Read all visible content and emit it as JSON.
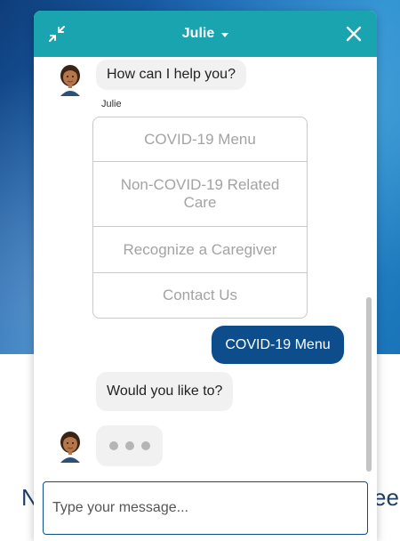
{
  "header": {
    "title": "Julie"
  },
  "conversation": {
    "bot_greeting": "How can I help you?",
    "sender_name": "Julie",
    "menu_options": [
      "COVID-19 Menu",
      "Non-COVID-19 Related Care",
      "Recognize a Caregiver",
      "Contact Us"
    ],
    "user_reply": "COVID-19 Menu",
    "bot_followup": "Would you like to?"
  },
  "composer": {
    "placeholder": "Type your message..."
  },
  "background": {
    "text_left": "N",
    "text_right": "ee"
  },
  "colors": {
    "header": "#1aa4b0",
    "user_bubble": "#0e4d8c",
    "bot_bubble": "#f1f1f1"
  },
  "icons": {
    "minimize": "minimize-arrows-icon",
    "dropdown": "caret-down-icon",
    "close": "close-icon",
    "avatar": "agent-avatar-icon"
  }
}
